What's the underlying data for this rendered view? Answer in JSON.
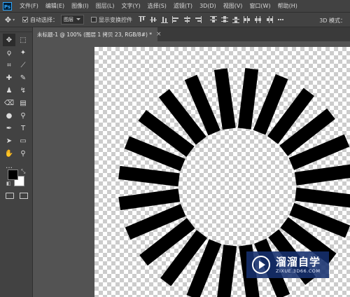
{
  "app": {
    "logo_text": "Ps"
  },
  "menu": [
    "文件(F)",
    "编辑(E)",
    "图像(I)",
    "图层(L)",
    "文字(Y)",
    "选择(S)",
    "滤镜(T)",
    "3D(D)",
    "视图(V)",
    "窗口(W)",
    "帮助(H)"
  ],
  "options": {
    "auto_select_label": "自动选择：",
    "auto_select_checked": true,
    "layer_select_value": "图层",
    "transform_label": "显示变换控件",
    "transform_checked": false,
    "mode3d_label": "3D 模式："
  },
  "document_tab": {
    "label": "未标题-1 @ 100% (图层 1 拷贝 23, RGB/8#) *",
    "close_glyph": "×"
  },
  "tools": [
    {
      "name": "move-tool",
      "glyph": "✥",
      "active": true
    },
    {
      "name": "marquee-tool",
      "glyph": "⬚"
    },
    {
      "name": "lasso-tool",
      "glyph": "ϙ"
    },
    {
      "name": "magic-wand-tool",
      "glyph": "✦"
    },
    {
      "name": "crop-tool",
      "glyph": "⌗"
    },
    {
      "name": "eyedropper-tool",
      "glyph": "⟋"
    },
    {
      "name": "healing-brush-tool",
      "glyph": "✚"
    },
    {
      "name": "brush-tool",
      "glyph": "✎"
    },
    {
      "name": "clone-stamp-tool",
      "glyph": "♟"
    },
    {
      "name": "history-brush-tool",
      "glyph": "↯"
    },
    {
      "name": "eraser-tool",
      "glyph": "⌫"
    },
    {
      "name": "gradient-tool",
      "glyph": "▤"
    },
    {
      "name": "blur-tool",
      "glyph": "●"
    },
    {
      "name": "dodge-tool",
      "glyph": "⚲"
    },
    {
      "name": "pen-tool",
      "glyph": "✒"
    },
    {
      "name": "type-tool",
      "glyph": "T"
    },
    {
      "name": "path-selection-tool",
      "glyph": "➤"
    },
    {
      "name": "shape-tool",
      "glyph": "▭"
    },
    {
      "name": "hand-tool",
      "glyph": "✋"
    },
    {
      "name": "zoom-tool",
      "glyph": "⚲"
    },
    {
      "name": "more-tools",
      "glyph": "…"
    }
  ],
  "colors": {
    "foreground": "#000000",
    "background": "#ffffff",
    "ui_dark": "#424242",
    "canvas_bg": "#535353"
  },
  "canvas_graphic": {
    "shape": "radial-burst",
    "ray_count": 24,
    "ray_color": "#000000"
  },
  "watermark": {
    "title": "溜溜自学",
    "url": "ZIXUE.3D66.COM"
  }
}
